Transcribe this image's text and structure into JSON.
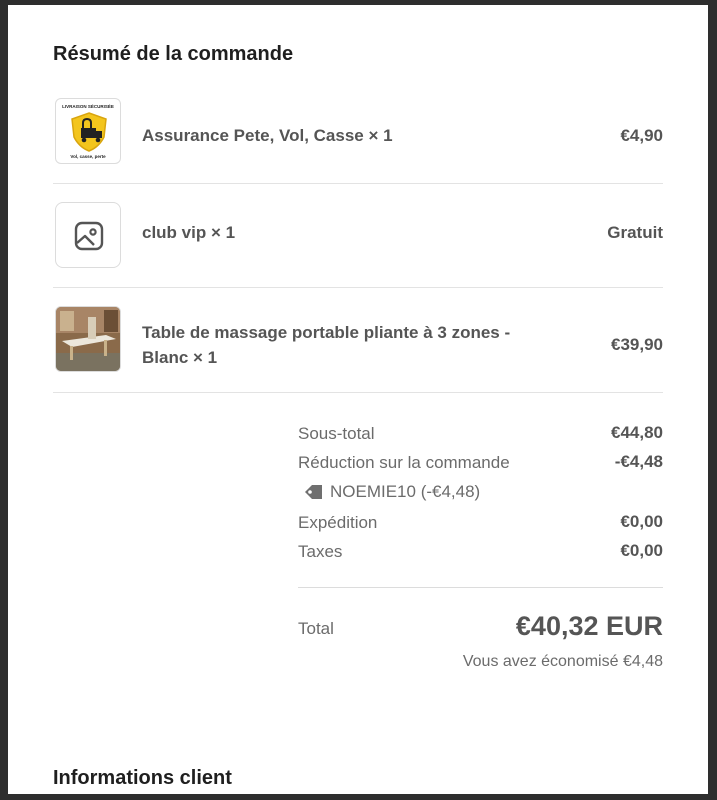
{
  "summary": {
    "title": "Résumé de la commande",
    "items": [
      {
        "name": "Assurance Pete, Vol, Casse × 1",
        "price": "€4,90",
        "badge_top": "LIVRAISON SÉCURISÉE",
        "badge_bottom": "Vol, casse, perte",
        "icon": "insurance-shield-icon"
      },
      {
        "name": "club vip × 1",
        "price": "Gratuit",
        "icon": "image-placeholder-icon"
      },
      {
        "name_line1": "Table de massage portable pliante à 3 zones -",
        "name_line2": "Blanc × 1",
        "price": "€39,90",
        "icon": "massage-table-photo"
      }
    ],
    "subtotal_label": "Sous-total",
    "subtotal_value": "€44,80",
    "discount_label": "Réduction sur la commande",
    "discount_value": "-€4,48",
    "discount_code": "NOEMIE10 (-€4,48)",
    "shipping_label": "Expédition",
    "shipping_value": "€0,00",
    "taxes_label": "Taxes",
    "taxes_value": "€0,00",
    "total_label": "Total",
    "total_value": "€40,32 EUR",
    "savings_text": "Vous avez économisé €4,48"
  },
  "customer": {
    "title": "Informations client"
  },
  "colors": {
    "shield": "#f3c51d",
    "text": "#555555",
    "muted": "#6b6b6b"
  }
}
